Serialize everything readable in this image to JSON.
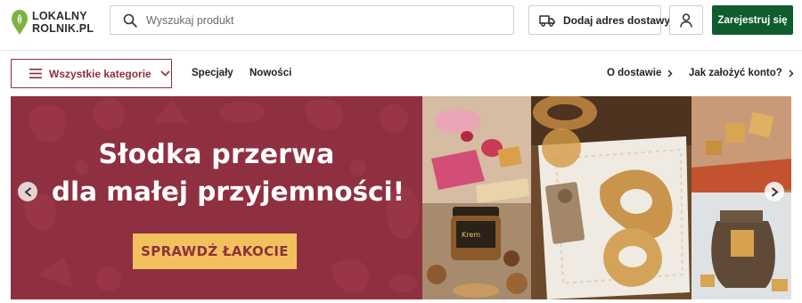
{
  "brand": {
    "line1": "LOKALNY",
    "line2": "ROLNIK.PL"
  },
  "search": {
    "placeholder": "Wyszukaj produkt",
    "value": ""
  },
  "header": {
    "delivery_label": "Dodaj adres dostawy",
    "register_label": "Zarejestruj się"
  },
  "nav": {
    "categories_label": "Wszystkie kategorie",
    "links": [
      "Specjały",
      "Nowości"
    ],
    "right_links": [
      "O dostawie",
      "Jak założyć konto?"
    ]
  },
  "hero": {
    "title_line1": "Słodka przerwa",
    "title_line2": "dla małej przyjemności!",
    "cta_label": "SPRAWDŹ ŁAKOCIE",
    "jar_label": "Krem",
    "background_color": "#8f3040",
    "cta_color": "#f2c15e"
  },
  "colors": {
    "brand_green": "#0f5c2e",
    "accent_maroon": "#8c2f3c",
    "logo_leaf": "#7cb342"
  },
  "icons": {
    "logo": "leaf-pin-icon",
    "search": "search-icon",
    "delivery": "truck-icon",
    "account": "user-icon",
    "categories": "hamburger-icon",
    "dropdown": "chevron-down-icon",
    "link_arrow": "chevron-right-icon",
    "slider_prev": "arrow-left-icon",
    "slider_next": "arrow-right-icon"
  }
}
